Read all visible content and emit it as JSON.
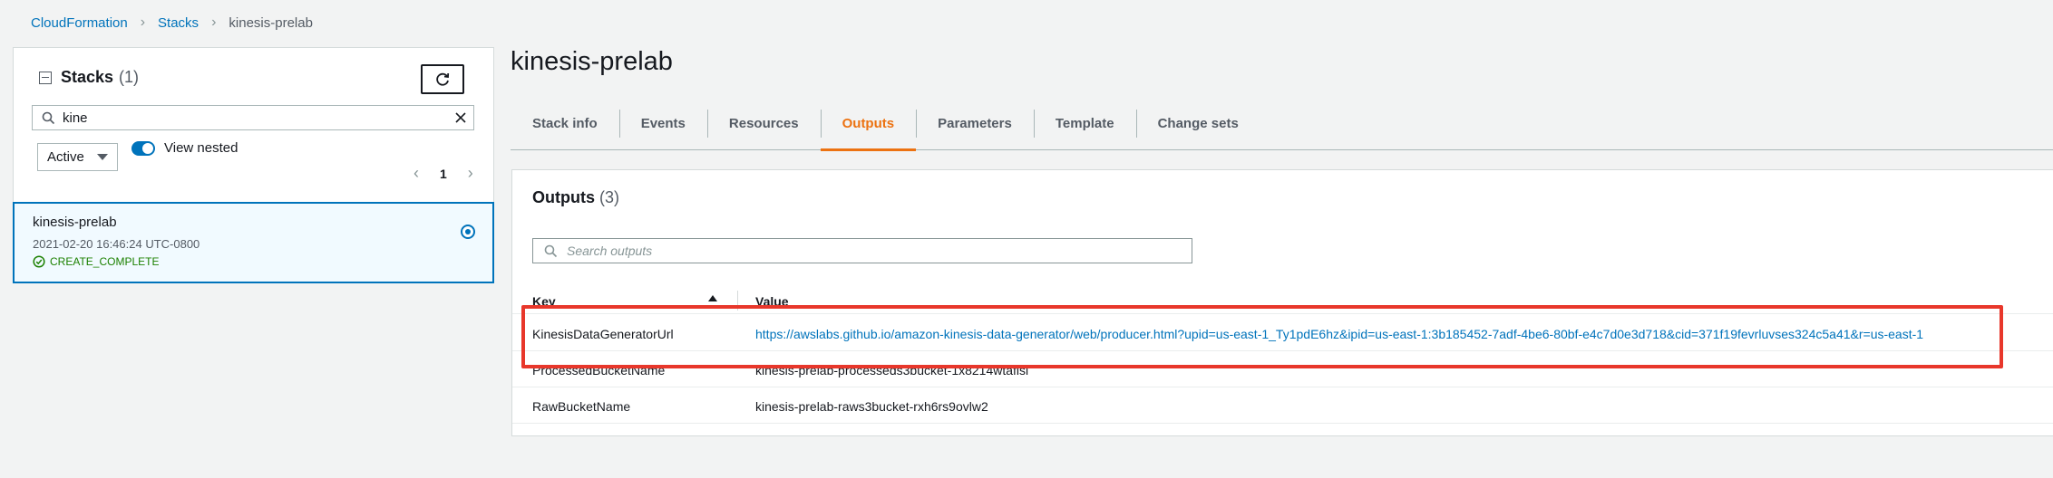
{
  "breadcrumb": {
    "items": [
      "CloudFormation",
      "Stacks"
    ],
    "current": "kinesis-prelab"
  },
  "left_panel": {
    "title": "Stacks",
    "count": "(1)",
    "search_value": "kine",
    "status_filter": "Active",
    "view_nested_label": "View nested",
    "page": "1",
    "stack": {
      "name": "kinesis-prelab",
      "date": "2021-02-20 16:46:24 UTC-0800",
      "status": "CREATE_COMPLETE"
    }
  },
  "stack_title": "kinesis-prelab",
  "tabs": [
    "Stack info",
    "Events",
    "Resources",
    "Outputs",
    "Parameters",
    "Template",
    "Change sets"
  ],
  "active_tab": "Outputs",
  "outputs": {
    "title": "Outputs",
    "count": "(3)",
    "search_placeholder": "Search outputs",
    "columns": {
      "key": "Key",
      "value": "Value"
    },
    "rows": [
      {
        "key": "KinesisDataGeneratorUrl",
        "value": "https://awslabs.github.io/amazon-kinesis-data-generator/web/producer.html?upid=us-east-1_Ty1pdE6hz&ipid=us-east-1:3b185452-7adf-4be6-80bf-e4c7d0e3d718&cid=371f19fevrluvses324c5a41&r=us-east-1"
      },
      {
        "key": "ProcessedBucketName",
        "value": "kinesis-prelab-processeds3bucket-1x8214wtafisl"
      },
      {
        "key": "RawBucketName",
        "value": "kinesis-prelab-raws3bucket-rxh6rs9ovlw2"
      }
    ]
  },
  "colors": {
    "link": "#0073bb",
    "active_tab": "#ec7211",
    "success": "#1d8102",
    "highlight": "#e8372b"
  }
}
